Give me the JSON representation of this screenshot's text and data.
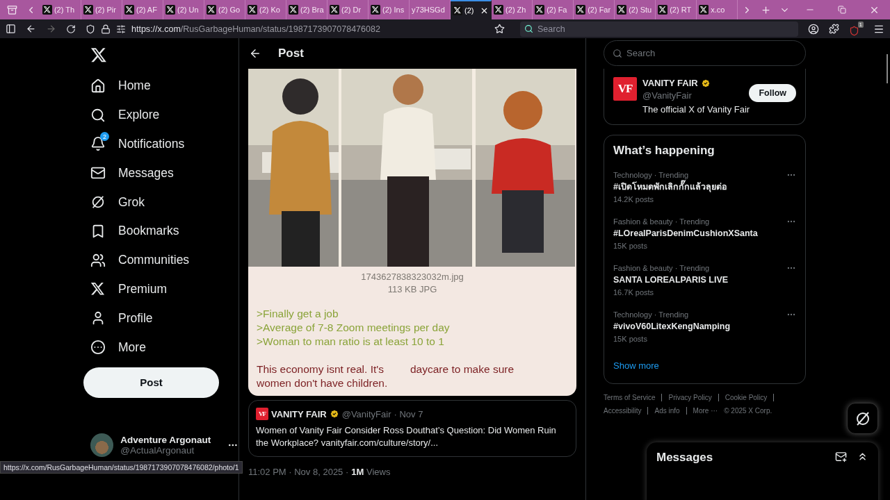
{
  "browser": {
    "tabs": [
      {
        "title": "(2) Th",
        "selected": false
      },
      {
        "title": "(2) Pir",
        "selected": false
      },
      {
        "title": "(2) AF",
        "selected": false
      },
      {
        "title": "(2) Un",
        "selected": false
      },
      {
        "title": "(2) Go",
        "selected": false
      },
      {
        "title": "(2) Ko",
        "selected": false
      },
      {
        "title": "(2) Bra",
        "selected": false
      },
      {
        "title": "(2) Dr",
        "selected": false
      },
      {
        "title": "(2) Ins",
        "selected": false
      },
      {
        "title": "y73HSGd",
        "selected": false,
        "favicon": false
      },
      {
        "title": "(2)",
        "selected": true
      },
      {
        "title": "(2) Zh",
        "selected": false
      },
      {
        "title": "(2) Fa",
        "selected": false
      },
      {
        "title": "(2) Far",
        "selected": false
      },
      {
        "title": "(2) Stu",
        "selected": false
      },
      {
        "title": "(2) RT",
        "selected": false
      },
      {
        "title": "x.co",
        "selected": false
      }
    ],
    "url_host": "https://x.com",
    "url_path": "/RusGarbageHuman/status/1987173907078476082",
    "search_placeholder": "Search",
    "extension_badge": "1"
  },
  "nav": {
    "items": [
      {
        "label": "Home"
      },
      {
        "label": "Explore"
      },
      {
        "label": "Notifications",
        "badge": "2"
      },
      {
        "label": "Messages"
      },
      {
        "label": "Grok"
      },
      {
        "label": "Bookmarks"
      },
      {
        "label": "Communities"
      },
      {
        "label": "Premium"
      },
      {
        "label": "Profile"
      },
      {
        "label": "More"
      }
    ],
    "post_button": "Post",
    "account": {
      "name": "Adventure Argonaut",
      "handle": "@ActualArgonaut"
    }
  },
  "post": {
    "header": "Post",
    "image": {
      "kind": "picture",
      "filename": "1743627838323032m.jpg",
      "filesize": "113 KB JPG",
      "greentext": [
        ">Finally get a job",
        ">Average of 7-8 Zoom meetings per day",
        ">Woman to man ratio is at least 10 to 1"
      ],
      "text_start": "This economy isnt real. It's",
      "text_mid": "daycare to make sure",
      "text_end": "women don't have children."
    },
    "quote": {
      "logo": "VF",
      "name": "VANITY FAIR",
      "handle": "@VanityFair",
      "date": "· Nov 7",
      "text": "Women of Vanity Fair Consider Ross Douthat’s Question: Did Women Ruin the Workplace?",
      "link": "vanityfair.com/culture/story/..."
    },
    "meta": {
      "time": "11:02 PM · Nov 8, 2025 ·",
      "views_count": "1M",
      "views_label": "Views"
    }
  },
  "right": {
    "search_placeholder": "Search",
    "follow": {
      "logo": "VF",
      "name": "VANITY FAIR",
      "handle": "@VanityFair",
      "bio": "The official X of Vanity Fair",
      "button": "Follow"
    },
    "trends": {
      "title": "What’s happening",
      "items": [
        {
          "category": "Technology · Trending",
          "name": "#เปิดโหมดพักเลิกกั๊กแล้วลุยต่อ",
          "posts": "14.2K posts"
        },
        {
          "category": "Fashion & beauty · Trending",
          "name": "#LOrealParisDenimCushionXSanta",
          "posts": "15K posts"
        },
        {
          "category": "Fashion & beauty · Trending",
          "name": "SANTA LOREALPARIS LIVE",
          "posts": "16.7K posts"
        },
        {
          "category": "Technology · Trending",
          "name": "#vivoV60LitexKengNamping",
          "posts": "15K posts"
        }
      ],
      "show_more": "Show more"
    },
    "footer_links": [
      "Terms of Service",
      "Privacy Policy",
      "Cookie Policy",
      "Accessibility",
      "Ads info",
      "More ···"
    ],
    "copyright": "© 2025 X Corp.",
    "messages_title": "Messages"
  },
  "status_url": "https://x.com/RusGarbageHuman/status/1987173907078476082/photo/1"
}
